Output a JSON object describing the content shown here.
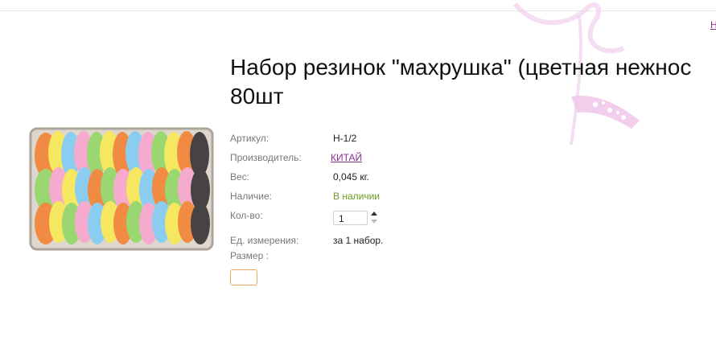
{
  "header": {
    "partial_link": "Н"
  },
  "product": {
    "title_line1": "Набор резинок \"махрушка\" (цветная нежнос",
    "title_line2": "80шт",
    "image_icon": "product-photo",
    "details": [
      {
        "label": "Артикул:",
        "value": "Н-1/2"
      },
      {
        "label": "Производитель:",
        "value": "КИТАЙ"
      },
      {
        "label": "Вес:",
        "value": "0,045 кг."
      },
      {
        "label": "Наличие:",
        "value": "В наличии"
      },
      {
        "label": "Кол-во:",
        "value": "1"
      },
      {
        "label": "Ед. измерения:",
        "value": "за 1 набор."
      },
      {
        "label": "Размер :",
        "value": ""
      }
    ]
  },
  "colors": {
    "link": "#8e2f8e",
    "in_stock": "#6a9a1f",
    "select_border": "#f0a860"
  }
}
